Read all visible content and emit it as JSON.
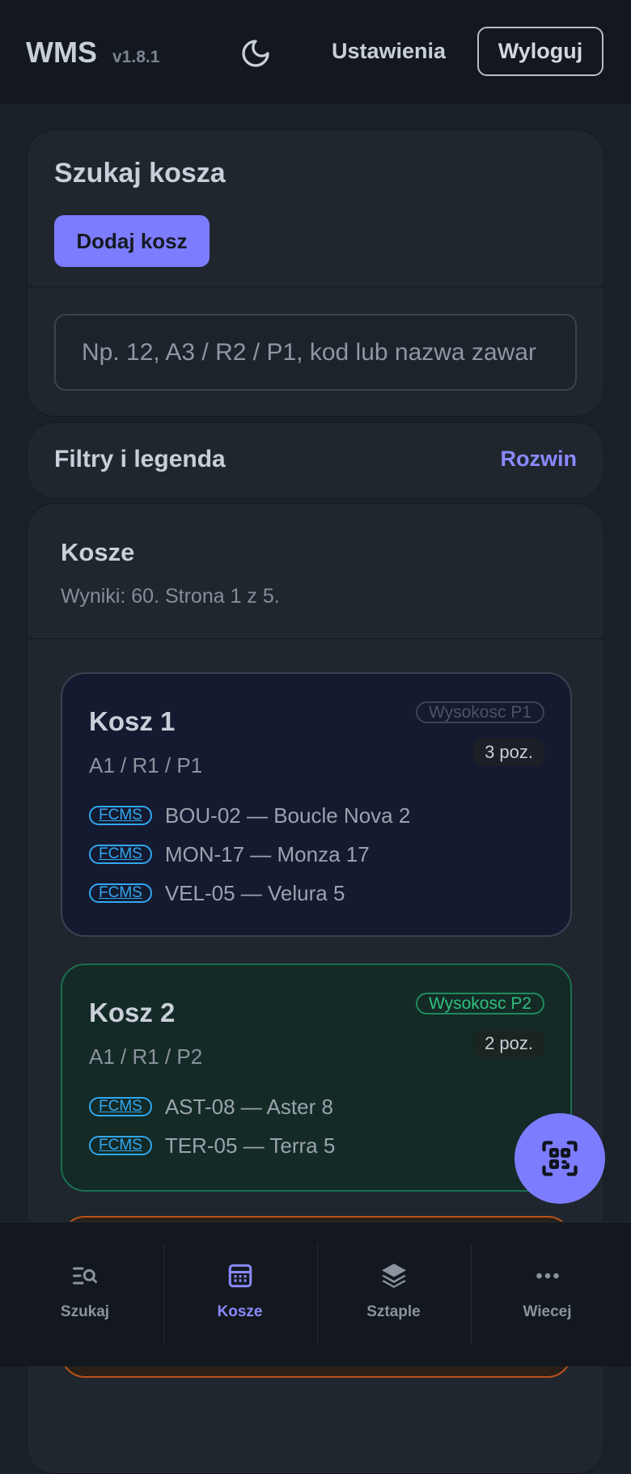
{
  "header": {
    "brand": "WMS",
    "version": "v1.8.1",
    "theme_icon": "moon-icon",
    "settings_label": "Ustawienia",
    "logout_label": "Wyloguj"
  },
  "search": {
    "title": "Szukaj kosza",
    "add_label": "Dodaj kosz",
    "placeholder": "Np. 12, A3 / R2 / P1, kod lub nazwa zawar"
  },
  "filters": {
    "title": "Filtry i legenda",
    "toggle_label": "Rozwin"
  },
  "bins_section": {
    "title": "Kosze",
    "summary": "Wyniki: 60. Strona 1 z 5."
  },
  "bins": [
    {
      "name": "Kosz 1",
      "location": "A1 / R1 / P1",
      "height_label": "Wysokosc P1",
      "count_label": "3 poz.",
      "items": [
        {
          "tag": "FCMS",
          "text": "BOU-02 — Boucle Nova 2"
        },
        {
          "tag": "FCMS",
          "text": "MON-17 — Monza 17"
        },
        {
          "tag": "FCMS",
          "text": "VEL-05 — Velura 5"
        }
      ]
    },
    {
      "name": "Kosz 2",
      "location": "A1 / R1 / P2",
      "height_label": "Wysokosc P2",
      "count_label": "2 poz.",
      "items": [
        {
          "tag": "FCMS",
          "text": "AST-08 — Aster 8"
        },
        {
          "tag": "FCMS",
          "text": "TER-05 — Terra 5"
        }
      ]
    }
  ],
  "fab": {
    "icon": "qr-scan-icon"
  },
  "nav": [
    {
      "label": "Szukaj",
      "icon": "search-list-icon",
      "active": false
    },
    {
      "label": "Kosze",
      "icon": "bin-grid-icon",
      "active": true
    },
    {
      "label": "Sztaple",
      "icon": "layers-icon",
      "active": false
    },
    {
      "label": "Wiecej",
      "icon": "more-dots-icon",
      "active": false
    }
  ],
  "colors": {
    "accent": "#7c7cff",
    "tag": "#31a7f0",
    "success": "#2fbf7d",
    "warning_border": "#b8521a"
  }
}
